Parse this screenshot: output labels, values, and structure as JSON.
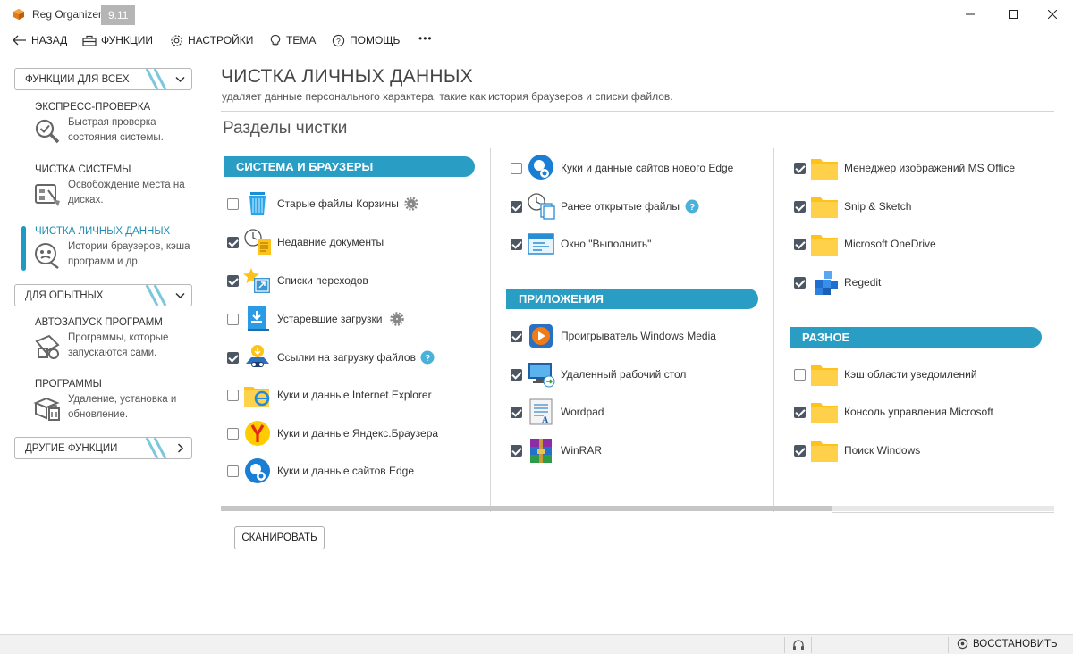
{
  "window": {
    "app_name": "Reg Organizer",
    "version": "9.11"
  },
  "toolbar": {
    "back": "НАЗАД",
    "functions": "ФУНКЦИИ",
    "settings": "НАСТРОЙКИ",
    "theme": "ТЕМА",
    "help": "ПОМОЩЬ",
    "more": "•••"
  },
  "sidebar": {
    "group_all": "ФУНКЦИИ ДЛЯ ВСЕХ",
    "group_advanced": "ДЛЯ ОПЫТНЫХ",
    "group_other": "ДРУГИЕ ФУНКЦИИ",
    "items": [
      {
        "title": "ЭКСПРЕСС-ПРОВЕРКА",
        "desc": "Быстрая проверка состояния системы.",
        "icon": "magnifier-check-icon"
      },
      {
        "title": "ЧИСТКА СИСТЕМЫ",
        "desc": "Освобождение места на дисках.",
        "icon": "disk-clean-icon"
      },
      {
        "title": "ЧИСТКА ЛИЧНЫХ ДАННЫХ",
        "desc": "Истории браузеров, кэша программ и др.",
        "icon": "privacy-icon",
        "active": true
      },
      {
        "title": "АВТОЗАПУСК ПРОГРАММ",
        "desc": "Программы, которые запускаются сами.",
        "icon": "autorun-icon"
      },
      {
        "title": "ПРОГРАММЫ",
        "desc": "Удаление, установка и обновление.",
        "icon": "programs-icon"
      }
    ]
  },
  "main": {
    "title": "ЧИСТКА ЛИЧНЫХ ДАННЫХ",
    "subtitle": "удаляет данные персонального характера, такие как история браузеров и списки файлов.",
    "sections_heading": "Разделы чистки",
    "scan_button": "СКАНИРОВАТЬ"
  },
  "categories": {
    "browsers": "СИСТЕМА И БРАУЗЕРЫ",
    "apps": "ПРИЛОЖЕНИЯ",
    "misc": "РАЗНОЕ"
  },
  "col1": [
    {
      "label": "Старые файлы Корзины",
      "checked": false,
      "icon": "recycle-bin-icon",
      "extra": "gear"
    },
    {
      "label": "Недавние документы",
      "checked": true,
      "icon": "recent-docs-icon"
    },
    {
      "label": "Списки переходов",
      "checked": true,
      "icon": "jumplist-icon"
    },
    {
      "label": "Устаревшие загрузки",
      "checked": false,
      "icon": "downloads-icon",
      "extra": "gear"
    },
    {
      "label": "Ссылки на загрузку файлов",
      "checked": true,
      "icon": "download-links-icon",
      "extra": "help"
    },
    {
      "label": "Куки и данные Internet Explorer",
      "checked": false,
      "icon": "internet-explorer-icon"
    },
    {
      "label": "Куки и данные Яндекс.Браузера",
      "checked": false,
      "icon": "yandex-browser-icon"
    },
    {
      "label": "Куки и данные сайтов Edge",
      "checked": false,
      "icon": "edge-cookie-icon"
    }
  ],
  "col2_top": [
    {
      "label": "Куки и данные сайтов нового Edge",
      "checked": false,
      "icon": "new-edge-cookie-icon"
    },
    {
      "label": "Ранее открытые файлы",
      "checked": true,
      "icon": "recent-files-icon",
      "extra": "help"
    },
    {
      "label": "Окно \"Выполнить\"",
      "checked": true,
      "icon": "run-dialog-icon"
    }
  ],
  "col2_apps": [
    {
      "label": "Проигрыватель Windows Media",
      "checked": true,
      "icon": "media-player-icon"
    },
    {
      "label": "Удаленный рабочий стол",
      "checked": true,
      "icon": "remote-desktop-icon"
    },
    {
      "label": "Wordpad",
      "checked": true,
      "icon": "wordpad-icon"
    },
    {
      "label": "WinRAR",
      "checked": true,
      "icon": "winrar-icon"
    }
  ],
  "col3_top": [
    {
      "label": "Менеджер изображений MS Office",
      "checked": true,
      "icon": "folder-icon"
    },
    {
      "label": "Snip & Sketch",
      "checked": true,
      "icon": "folder-icon"
    },
    {
      "label": "Microsoft OneDrive",
      "checked": true,
      "icon": "folder-icon"
    },
    {
      "label": "Regedit",
      "checked": true,
      "icon": "regedit-icon"
    }
  ],
  "col3_misc": [
    {
      "label": "Кэш области уведомлений",
      "checked": false,
      "icon": "folder-icon"
    },
    {
      "label": "Консоль управления Microsoft",
      "checked": true,
      "icon": "folder-icon"
    },
    {
      "label": "Поиск Windows",
      "checked": true,
      "icon": "folder-icon"
    }
  ],
  "statusbar": {
    "restore": "ВОССТАНОВИТЬ"
  },
  "colors": {
    "accent": "#2a9dc4",
    "checkbox_checked": "#4d5763",
    "folder": "#ffc52e"
  }
}
